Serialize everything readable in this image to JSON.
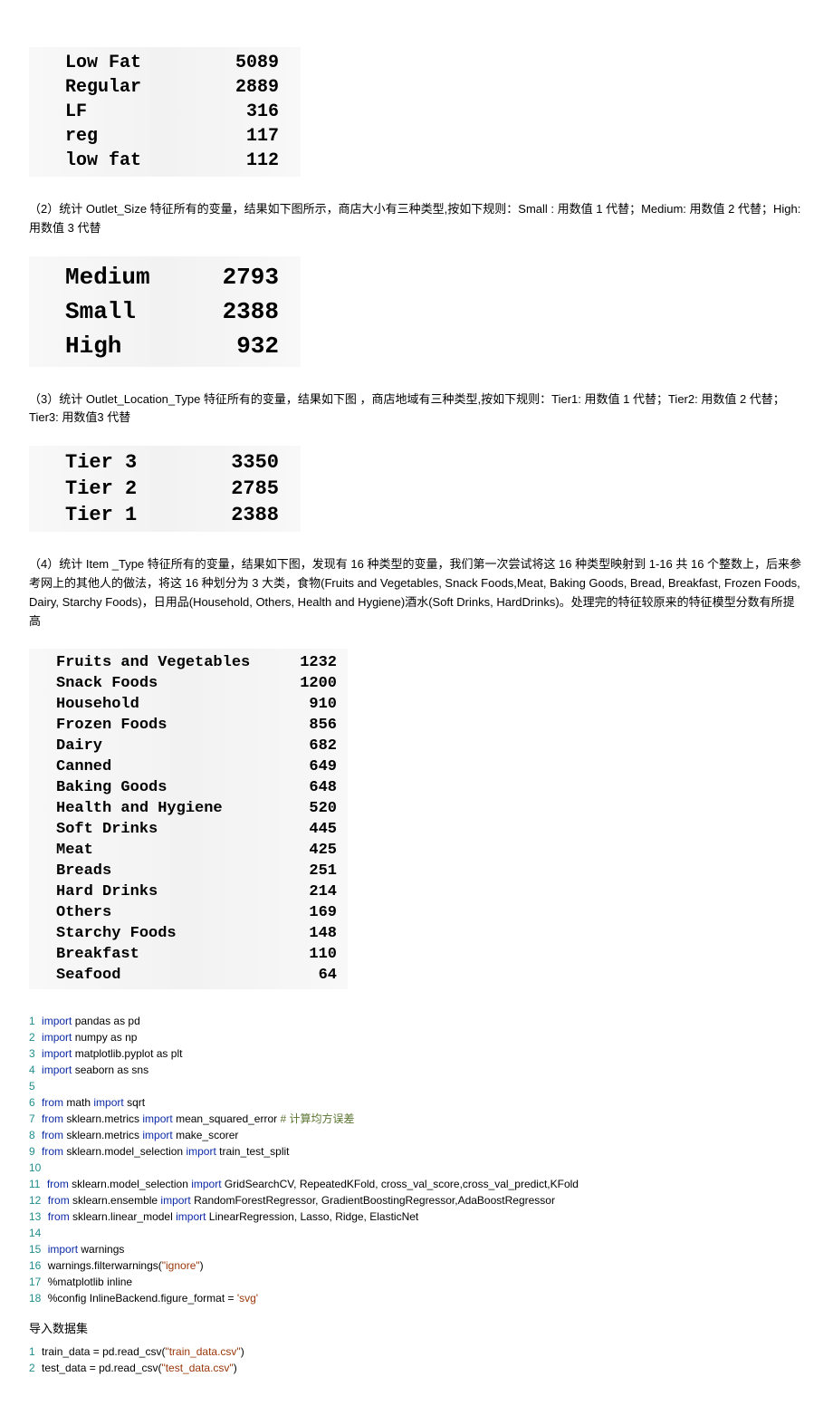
{
  "table1": [
    {
      "label": "Low Fat",
      "value": "5089"
    },
    {
      "label": "Regular",
      "value": "2889"
    },
    {
      "label": "LF",
      "value": "316"
    },
    {
      "label": "reg",
      "value": "117"
    },
    {
      "label": "low fat",
      "value": "112"
    }
  ],
  "para1": "（2）统计 Outlet_Size 特征所有的变量，结果如下图所示，商店大小有三种类型,按如下规则：Small : 用数值 1 代替；Medium: 用数值 2 代替；High: 用数值 3 代替",
  "table2": [
    {
      "label": "Medium",
      "value": "2793"
    },
    {
      "label": "Small",
      "value": "2388"
    },
    {
      "label": "High",
      "value": "932"
    }
  ],
  "para2": "（3）统计 Outlet_Location_Type 特征所有的变量，结果如下图 ，商店地域有三种类型,按如下规则：Tier1: 用数值 1 代替；Tier2: 用数值 2 代替；Tier3: 用数值3 代替",
  "table3": [
    {
      "label": "Tier 3",
      "value": "3350"
    },
    {
      "label": "Tier 2",
      "value": "2785"
    },
    {
      "label": "Tier 1",
      "value": "2388"
    }
  ],
  "para3": "（4）统计 Item _Type 特征所有的变量，结果如下图，发现有 16 种类型的变量，我们第一次尝试将这 16 种类型映射到 1-16 共 16 个整数上，后来参考网上的其他人的做法，将这 16 种划分为 3 大类，食物(Fruits and Vegetables, Snack Foods,Meat, Baking Goods, Bread, Breakfast, Frozen Foods, Dairy, Starchy Foods)，日用品(Household, Others, Health and Hygiene)酒水(Soft Drinks, HardDrinks)。处理完的特征较原来的特征模型分数有所提高",
  "table4": [
    {
      "label": "Fruits and Vegetables",
      "value": "1232"
    },
    {
      "label": "Snack Foods",
      "value": "1200"
    },
    {
      "label": "Household",
      "value": "910"
    },
    {
      "label": "Frozen Foods",
      "value": "856"
    },
    {
      "label": "Dairy",
      "value": "682"
    },
    {
      "label": "Canned",
      "value": "649"
    },
    {
      "label": "Baking Goods",
      "value": "648"
    },
    {
      "label": "Health and Hygiene",
      "value": "520"
    },
    {
      "label": "Soft Drinks",
      "value": "445"
    },
    {
      "label": "Meat",
      "value": "425"
    },
    {
      "label": "Breads",
      "value": "251"
    },
    {
      "label": "Hard Drinks",
      "value": "214"
    },
    {
      "label": "Others",
      "value": "169"
    },
    {
      "label": "Starchy Foods",
      "value": "148"
    },
    {
      "label": "Breakfast",
      "value": "110"
    },
    {
      "label": "Seafood",
      "value": "64"
    }
  ],
  "code1": [
    {
      "n": "1",
      "tokens": [
        {
          "t": "import",
          "c": "kw"
        },
        {
          "t": " pandas as pd"
        }
      ]
    },
    {
      "n": "2",
      "tokens": [
        {
          "t": "import",
          "c": "kw"
        },
        {
          "t": " numpy as np"
        }
      ]
    },
    {
      "n": "3",
      "tokens": [
        {
          "t": "import",
          "c": "kw"
        },
        {
          "t": " matplotlib.pyplot as plt"
        }
      ]
    },
    {
      "n": "4",
      "tokens": [
        {
          "t": "import",
          "c": "kw"
        },
        {
          "t": " seaborn as sns"
        }
      ]
    },
    {
      "n": "5",
      "tokens": []
    },
    {
      "n": "6",
      "tokens": [
        {
          "t": "from",
          "c": "kw"
        },
        {
          "t": " math "
        },
        {
          "t": "import",
          "c": "kw"
        },
        {
          "t": " sqrt"
        }
      ]
    },
    {
      "n": "7",
      "tokens": [
        {
          "t": "from",
          "c": "kw"
        },
        {
          "t": " sklearn.metrics "
        },
        {
          "t": "import",
          "c": "kw"
        },
        {
          "t": " mean_squared_error "
        },
        {
          "t": "# 计算均方误差",
          "c": "cm"
        }
      ]
    },
    {
      "n": "8",
      "tokens": [
        {
          "t": "from",
          "c": "kw"
        },
        {
          "t": " sklearn.metrics "
        },
        {
          "t": "import",
          "c": "kw"
        },
        {
          "t": " make_scorer"
        }
      ]
    },
    {
      "n": "9",
      "tokens": [
        {
          "t": "from",
          "c": "kw"
        },
        {
          "t": " sklearn.model_selection "
        },
        {
          "t": "import",
          "c": "kw"
        },
        {
          "t": " train_test_split"
        }
      ]
    },
    {
      "n": "10",
      "tokens": []
    },
    {
      "n": "11",
      "tokens": [
        {
          "t": "from",
          "c": "kw"
        },
        {
          "t": " sklearn.model_selection "
        },
        {
          "t": "import",
          "c": "kw"
        },
        {
          "t": " GridSearchCV, RepeatedKFold, cross_val_score,cross_val_predict,KFold"
        }
      ]
    },
    {
      "n": "12",
      "tokens": [
        {
          "t": "from",
          "c": "kw"
        },
        {
          "t": " sklearn.ensemble "
        },
        {
          "t": "import",
          "c": "kw"
        },
        {
          "t": " RandomForestRegressor, GradientBoostingRegressor,AdaBoostRegressor"
        }
      ]
    },
    {
      "n": "13",
      "tokens": [
        {
          "t": "from",
          "c": "kw"
        },
        {
          "t": " sklearn.linear_model "
        },
        {
          "t": "import",
          "c": "kw"
        },
        {
          "t": " LinearRegression, Lasso, Ridge, ElasticNet"
        }
      ]
    },
    {
      "n": "14",
      "tokens": []
    },
    {
      "n": "15",
      "tokens": [
        {
          "t": "import",
          "c": "kw"
        },
        {
          "t": " warnings"
        }
      ]
    },
    {
      "n": "16",
      "tokens": [
        {
          "t": "warnings.filterwarnings("
        },
        {
          "t": "\"ignore\"",
          "c": "st"
        },
        {
          "t": ")"
        }
      ]
    },
    {
      "n": "17",
      "tokens": [
        {
          "t": "%matplotlib inline"
        }
      ]
    },
    {
      "n": "18",
      "tokens": [
        {
          "t": "%config InlineBackend.figure_format = "
        },
        {
          "t": "'svg'",
          "c": "st"
        }
      ]
    }
  ],
  "section1": "导入数据集",
  "code2": [
    {
      "n": "1",
      "tokens": [
        {
          "t": "train_data = pd.read_csv("
        },
        {
          "t": "\"train_data.csv\"",
          "c": "st"
        },
        {
          "t": ")"
        }
      ]
    },
    {
      "n": "2",
      "tokens": [
        {
          "t": "test_data = pd.read_csv("
        },
        {
          "t": "\"test_data.csv\"",
          "c": "st"
        },
        {
          "t": ")"
        }
      ]
    }
  ]
}
